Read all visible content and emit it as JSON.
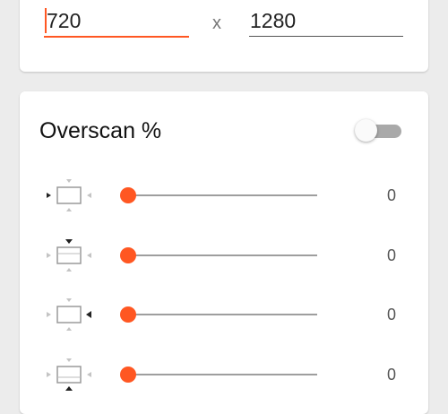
{
  "resolution": {
    "width": "720",
    "separator": "x",
    "height": "1280"
  },
  "overscan": {
    "title": "Overscan %",
    "enabled": false,
    "rows": [
      {
        "side": "left",
        "icon": "overscan-left-icon",
        "value": "0"
      },
      {
        "side": "top",
        "icon": "overscan-top-icon",
        "value": "0"
      },
      {
        "side": "right",
        "icon": "overscan-right-icon",
        "value": "0"
      },
      {
        "side": "bottom",
        "icon": "overscan-bottom-icon",
        "value": "0"
      }
    ]
  },
  "colors": {
    "accent": "#ff5722",
    "background": "#ececec",
    "card": "#ffffff",
    "toggle_off_track": "#a9a9a9"
  }
}
